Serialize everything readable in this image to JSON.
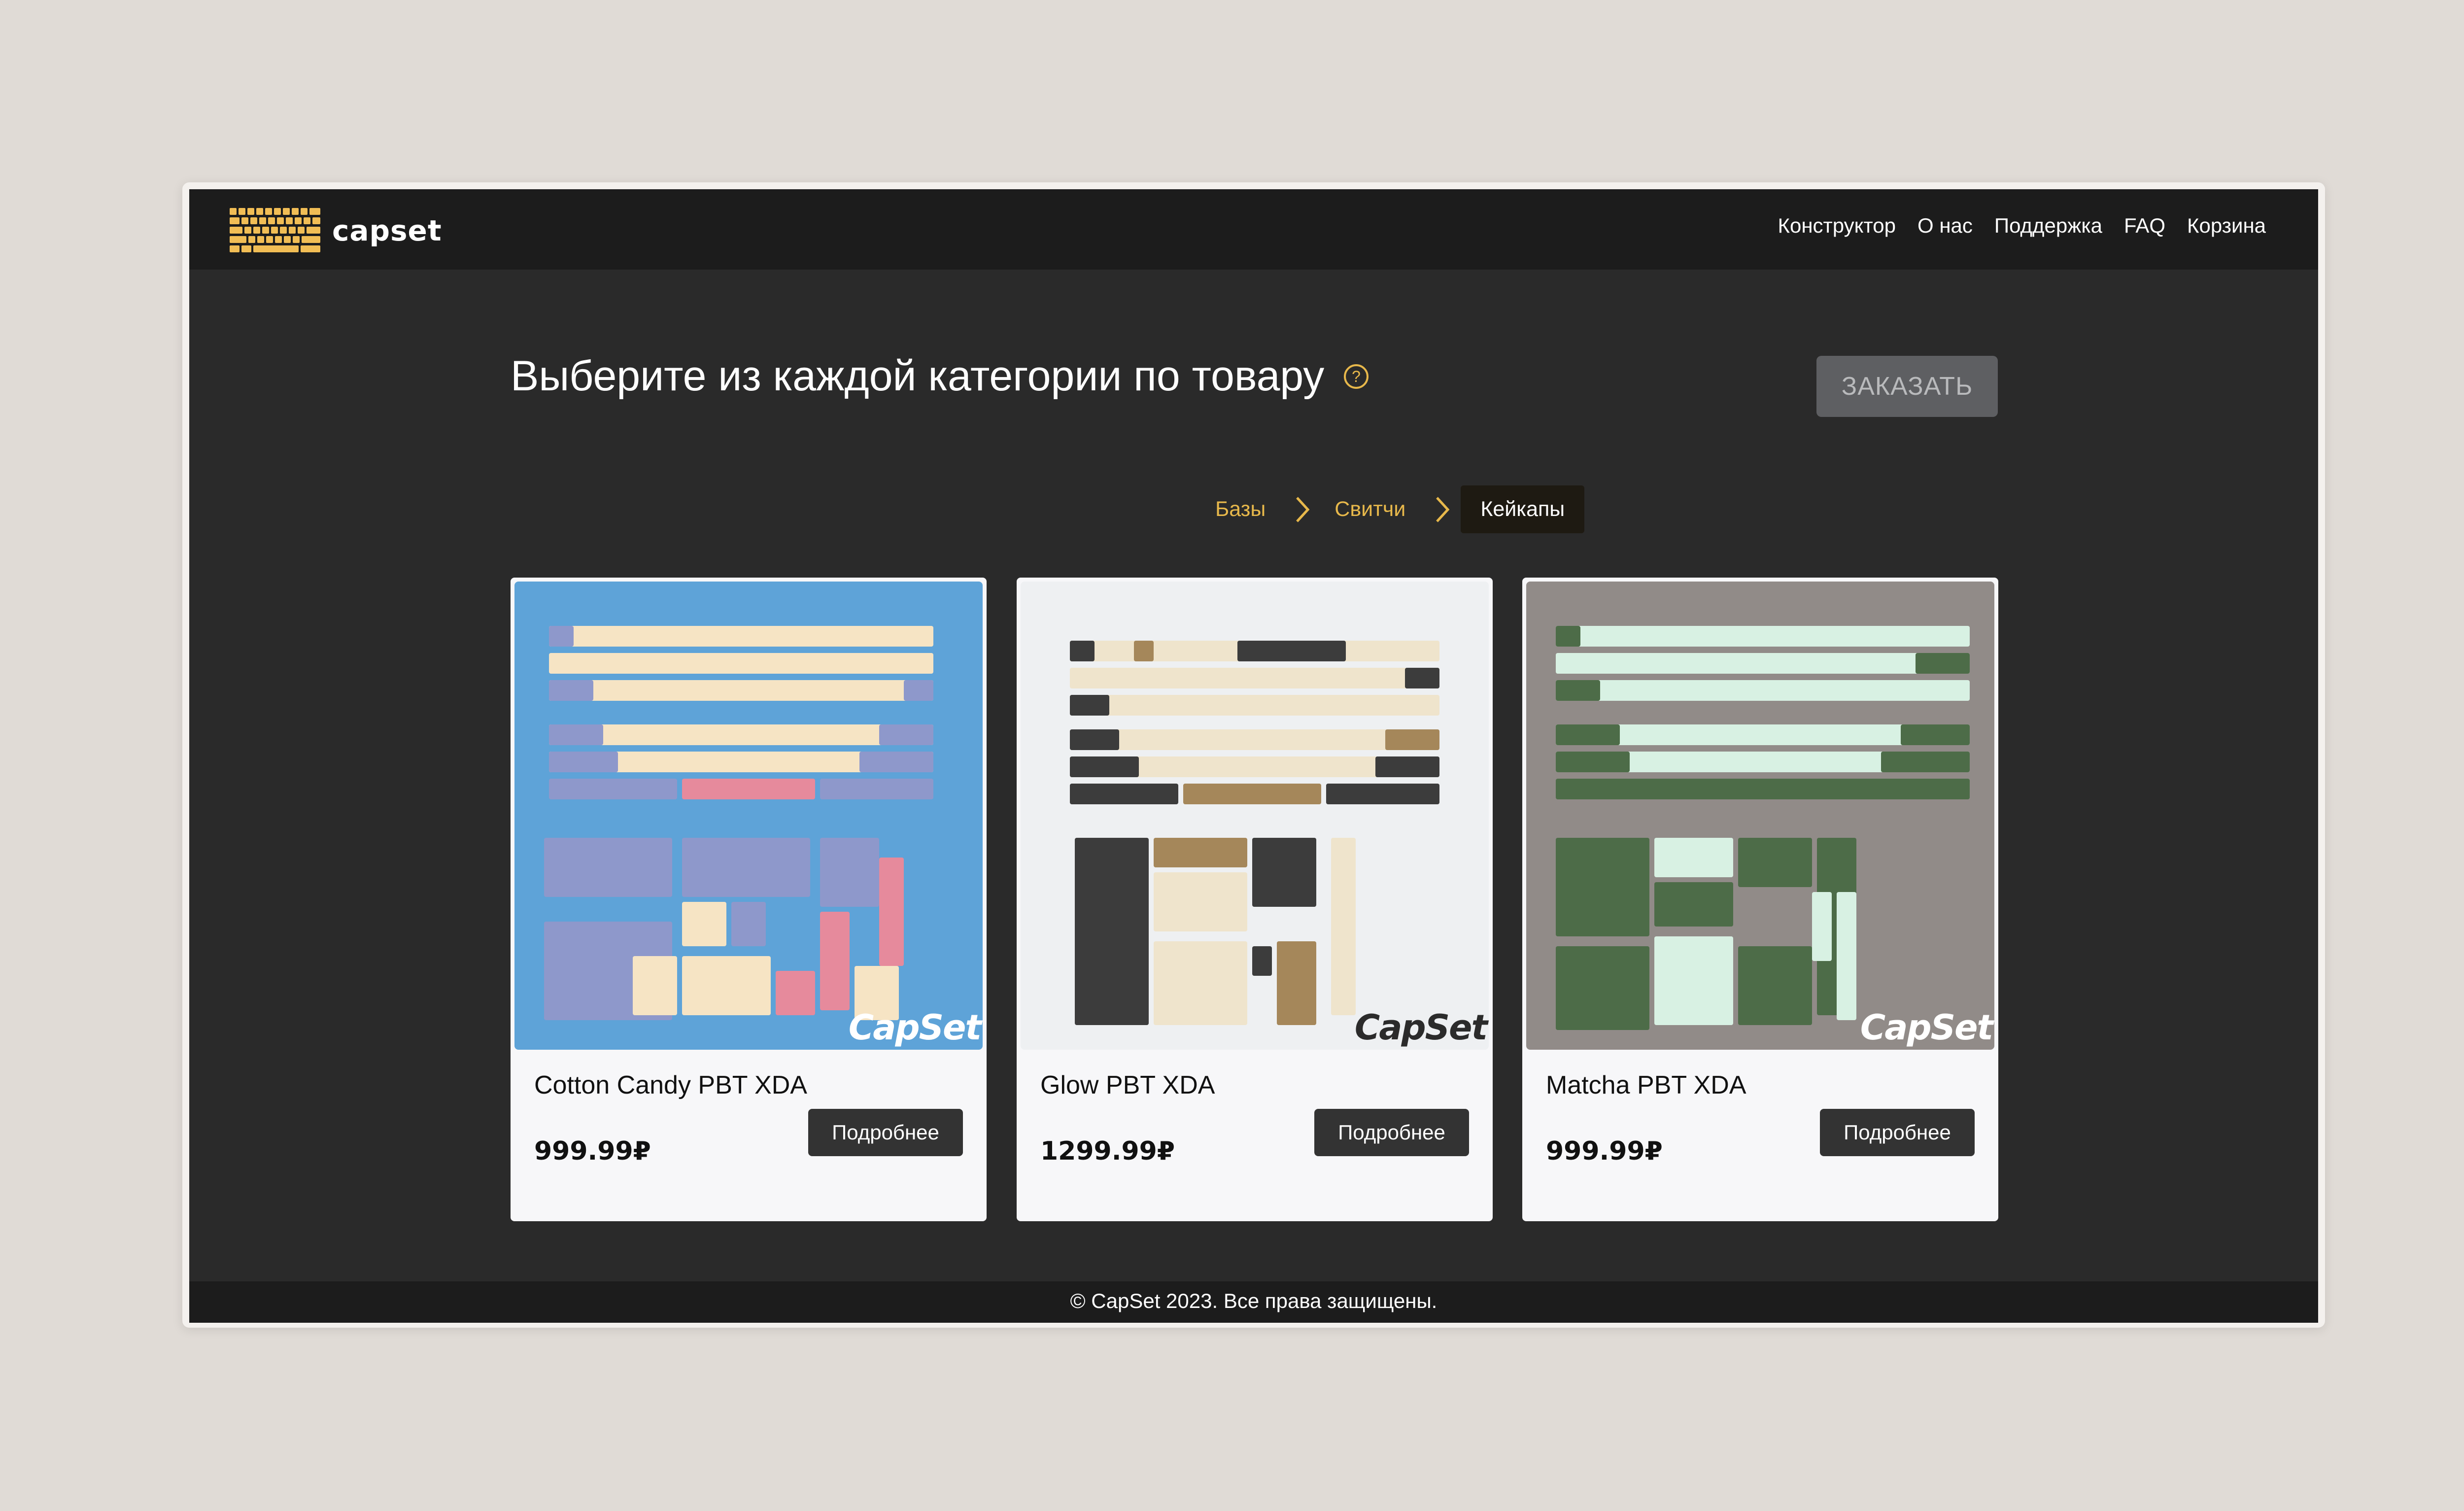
{
  "brand": {
    "name": "capset",
    "accent": "#e7b84b"
  },
  "nav": {
    "items": [
      "Конструктор",
      "О нас",
      "Поддержка",
      "FAQ",
      "Корзина"
    ]
  },
  "main": {
    "headline": "Выберите из каждой категории по товару",
    "help_icon": "question-circle-icon",
    "order_button": "ЗАКАЗАТЬ"
  },
  "breadcrumb": {
    "steps": [
      "Базы",
      "Свитчи",
      "Кейкапы"
    ],
    "separator_icon": "chevron-right-icon",
    "active_index": 2
  },
  "products": [
    {
      "title": "Cotton Candy PBT XDA",
      "price": "999.99₽",
      "button": "Подробнее",
      "image_watermark": "CapSet",
      "image_bg": "#5ea3d8"
    },
    {
      "title": "Glow PBT XDA",
      "price": "1299.99₽",
      "button": "Подробнее",
      "image_watermark": "CapSet",
      "image_bg": "#eef0f2"
    },
    {
      "title": "Matcha PBT XDA",
      "price": "999.99₽",
      "button": "Подробнее",
      "image_watermark": "CapSet",
      "image_bg": "#918b88"
    }
  ],
  "footer": {
    "text": "© CapSet 2023. Все права защищены."
  }
}
